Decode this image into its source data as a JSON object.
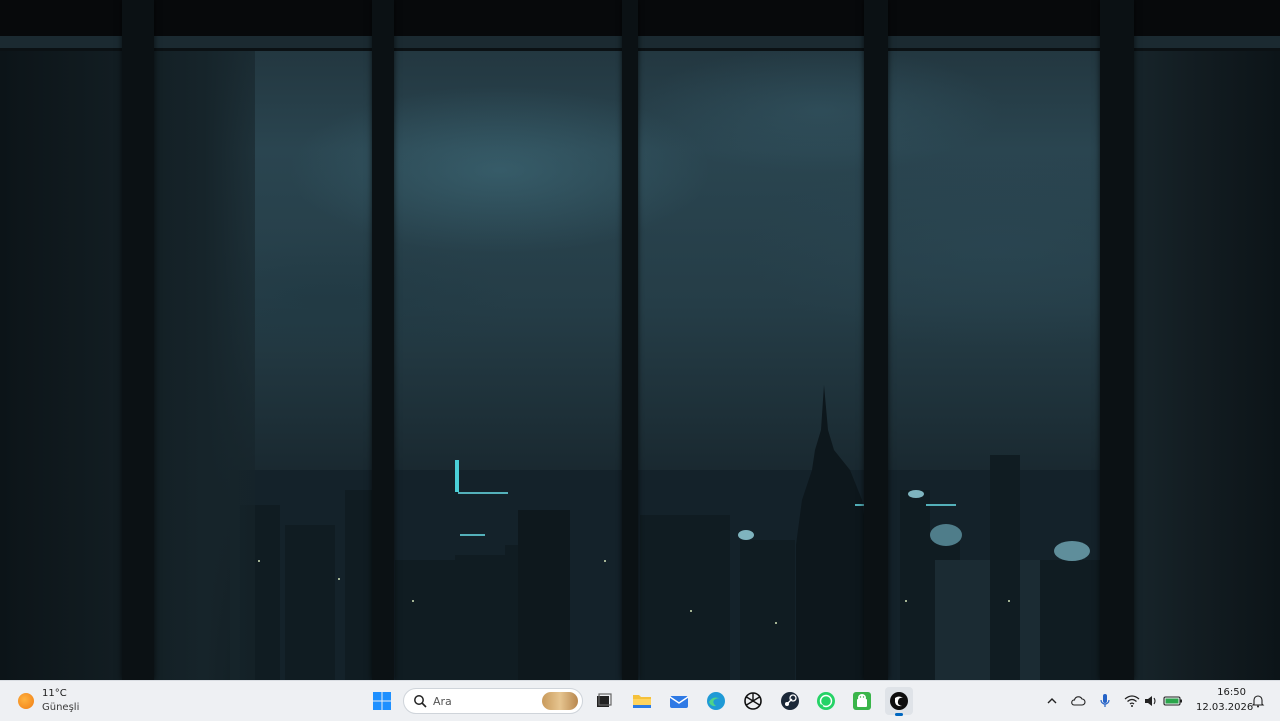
{
  "wallpaper": {
    "description_icon": "rainy-city-window-wallpaper"
  },
  "taskbar": {
    "weather": {
      "temperature": "11°C",
      "condition": "Güneşli",
      "icon": "sun-icon"
    },
    "start": {
      "icon": "windows-logo-icon"
    },
    "search": {
      "placeholder": "Ara",
      "icon": "search-icon"
    },
    "apps": [
      {
        "name": "task-view",
        "icon": "task-view-icon"
      },
      {
        "name": "file-explorer",
        "icon": "folder-icon"
      },
      {
        "name": "mail",
        "icon": "mail-icon"
      },
      {
        "name": "edge",
        "icon": "edge-icon"
      },
      {
        "name": "chatgpt",
        "icon": "chatgpt-icon"
      },
      {
        "name": "steam",
        "icon": "steam-icon"
      },
      {
        "name": "whatsapp",
        "icon": "whatsapp-icon"
      },
      {
        "name": "android-app",
        "icon": "android-icon"
      },
      {
        "name": "active-app",
        "icon": "app-icon",
        "active": true
      }
    ],
    "tray": {
      "icons": [
        "chevron-up-icon",
        "cloud-icon",
        "microphone-icon",
        "wifi-icon",
        "speaker-icon",
        "battery-icon"
      ],
      "time": "16:50",
      "date": "12.03.2026",
      "notification_icon": "notification-icon"
    }
  },
  "colors": {
    "accent": "#0067c0",
    "taskbar_bg": "#eef0f3"
  }
}
